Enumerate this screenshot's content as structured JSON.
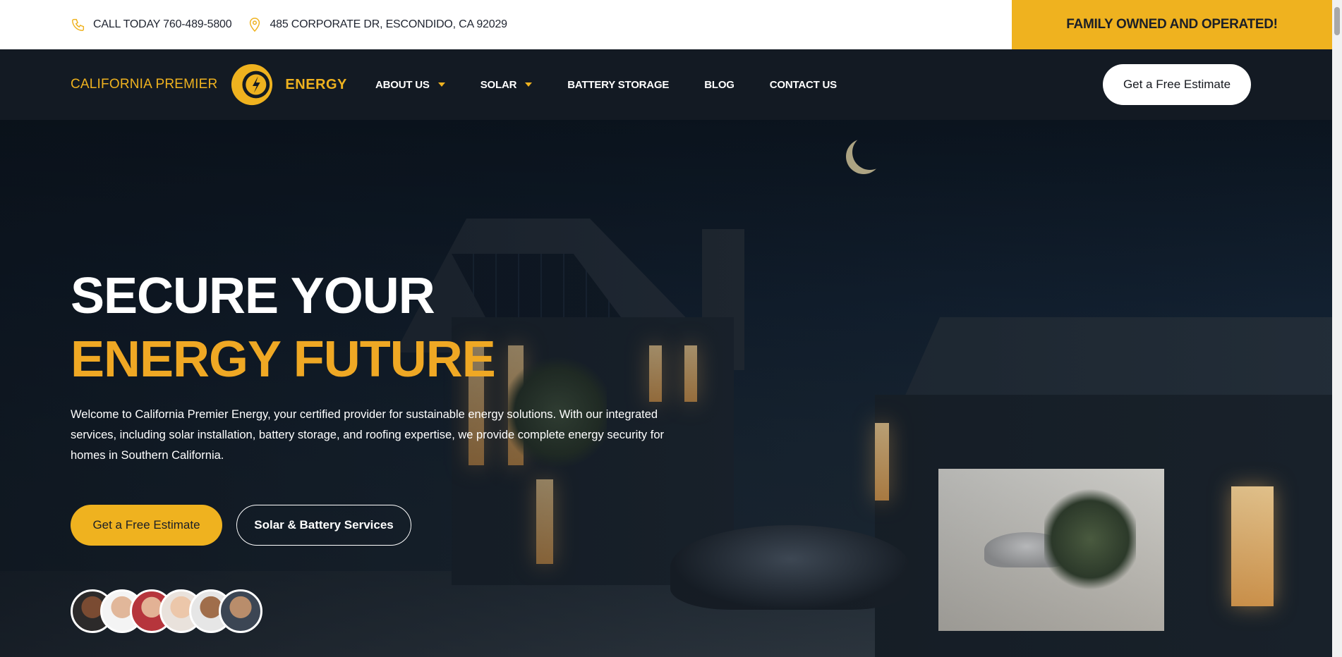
{
  "topbar": {
    "phone": "CALL TODAY 760-489-5800",
    "address": "485 CORPORATE DR, ESCONDIDO, CA 92029",
    "badge": "FAMILY OWNED AND OPERATED!",
    "icons": [
      "phone-icon",
      "map-pin-icon"
    ]
  },
  "nav": {
    "logo_left": "CALIFORNIA PREMIER",
    "logo_right": "ENERGY",
    "items": [
      {
        "label": "ABOUT US",
        "dropdown": true
      },
      {
        "label": "SOLAR",
        "dropdown": true
      },
      {
        "label": "BATTERY STORAGE",
        "dropdown": false
      },
      {
        "label": "BLOG",
        "dropdown": false
      },
      {
        "label": "CONTACT US",
        "dropdown": false
      }
    ],
    "cta": "Get a Free Estimate"
  },
  "hero": {
    "title_line1": "SECURE YOUR",
    "title_line2": "ENERGY FUTURE",
    "description": "Welcome to California Premier Energy, your certified provider for sustainable energy solutions. With our integrated services, including solar installation, battery storage, and roofing expertise, we provide complete energy security for homes in Southern California.",
    "primary_button": "Get a Free Estimate",
    "secondary_button": "Solar & Battery Services",
    "avatars": 6
  },
  "colors": {
    "accent": "#efb21f",
    "headline_accent": "#efa824",
    "nav_bg": "#131a23",
    "white": "#ffffff"
  }
}
